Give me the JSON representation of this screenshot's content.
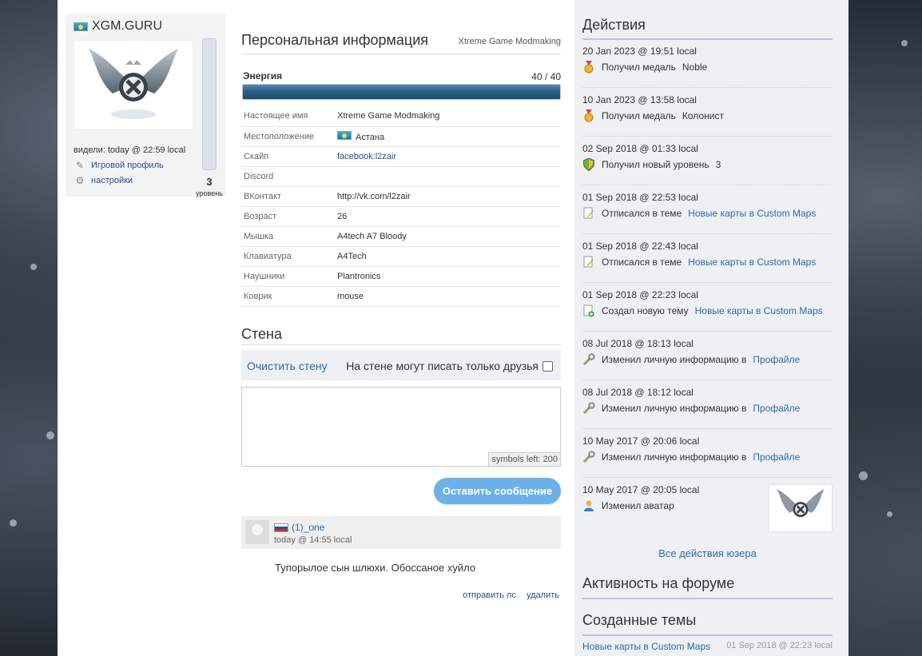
{
  "profile": {
    "username": "XGM.GURU",
    "level": "3",
    "level_label": "уровень",
    "seen": "видели: today @ 22:59 local",
    "game_profile": "Игровой профиль",
    "settings": "настройки"
  },
  "personal": {
    "title": "Персональная информация",
    "subtitle": "Xtreme Game Modmaking",
    "energy_label": "Энергия",
    "energy_value": "40 / 40",
    "energy_fraction": 1.0,
    "rows": [
      {
        "key": "Настоящее имя",
        "value": "Xtreme Game Modmaking"
      },
      {
        "key": "Местоположение",
        "value": "Астана"
      },
      {
        "key": "Скайп",
        "value": "facebook:l2zair"
      },
      {
        "key": "Discord",
        "value": ""
      },
      {
        "key": "ВКонтакт",
        "value": "http://vk.com/l2zair"
      },
      {
        "key": "Возраст",
        "value": "26"
      },
      {
        "key": "Мышка",
        "value": "A4tech A7 Bloody"
      },
      {
        "key": "Клавиатура",
        "value": "A4Tech"
      },
      {
        "key": "Наушники",
        "value": "Plantronics"
      },
      {
        "key": "Коврик",
        "value": "mouse"
      }
    ]
  },
  "wall": {
    "title": "Стена",
    "clear": "Очистить стену",
    "friends_only": "На стене могут писать только друзья",
    "symbols_left": "symbols left: 200",
    "post_button": "Оставить сообщение",
    "message": {
      "author": "(1)_one",
      "date": "today @ 14:55 local",
      "text": "Тупорылое сын шлюхи. Обоссаное хуйло",
      "send_pm": "отправить лс",
      "delete": "удалить"
    }
  },
  "actions": {
    "title": "Действия",
    "items": [
      {
        "date": "20 Jan 2023 @ 19:51 local",
        "text": "Получил медаль",
        "extra": "Noble",
        "link": "",
        "icon": "medal-icon"
      },
      {
        "date": "10 Jan 2023 @ 13:58 local",
        "text": "Получил медаль",
        "extra": "Колонист",
        "link": "",
        "icon": "medal-icon"
      },
      {
        "date": "02 Sep 2018 @ 01:33 local",
        "text": "Получил новый уровень",
        "extra": "3",
        "link": "",
        "icon": "shield-icon"
      },
      {
        "date": "01 Sep 2018 @ 22:53 local",
        "text": "Отписался в теме",
        "extra": "",
        "link": "Новые карты в Custom Maps",
        "icon": "edit-icon"
      },
      {
        "date": "01 Sep 2018 @ 22:43 local",
        "text": "Отписался в теме",
        "extra": "",
        "link": "Новые карты в Custom Maps",
        "icon": "edit-icon"
      },
      {
        "date": "01 Sep 2018 @ 22:23 local",
        "text": "Создал новую тему",
        "extra": "",
        "link": "Новые карты в Custom Maps",
        "icon": "new-topic-icon"
      },
      {
        "date": "08 Jul 2018 @ 18:13 local",
        "text": "Изменил личную информацию в",
        "extra": "",
        "link": "Профайле",
        "icon": "wrench-icon"
      },
      {
        "date": "08 Jul 2018 @ 18:12 local",
        "text": "Изменил личную информацию в",
        "extra": "",
        "link": "Профайле",
        "icon": "wrench-icon"
      },
      {
        "date": "10 May 2017 @ 20:06 local",
        "text": "Изменил личную информацию в",
        "extra": "",
        "link": "Профайле",
        "icon": "wrench-icon"
      },
      {
        "date": "10 May 2017 @ 20:05 local",
        "text": "Изменил аватар",
        "extra": "",
        "link": "",
        "icon": "user-icon"
      }
    ],
    "all_link": "Все действия юзера"
  },
  "forum": {
    "activity_title": "Активность на форуме",
    "topics_title": "Созданные темы",
    "topic": {
      "title": "Новые карты в Custom Maps",
      "date": "01 Sep 2018 @ 22:23 local"
    }
  },
  "colors": {
    "accent": "#2a6bb0",
    "energy_bar": "#2f5f86",
    "button": "#6cb2e8"
  }
}
